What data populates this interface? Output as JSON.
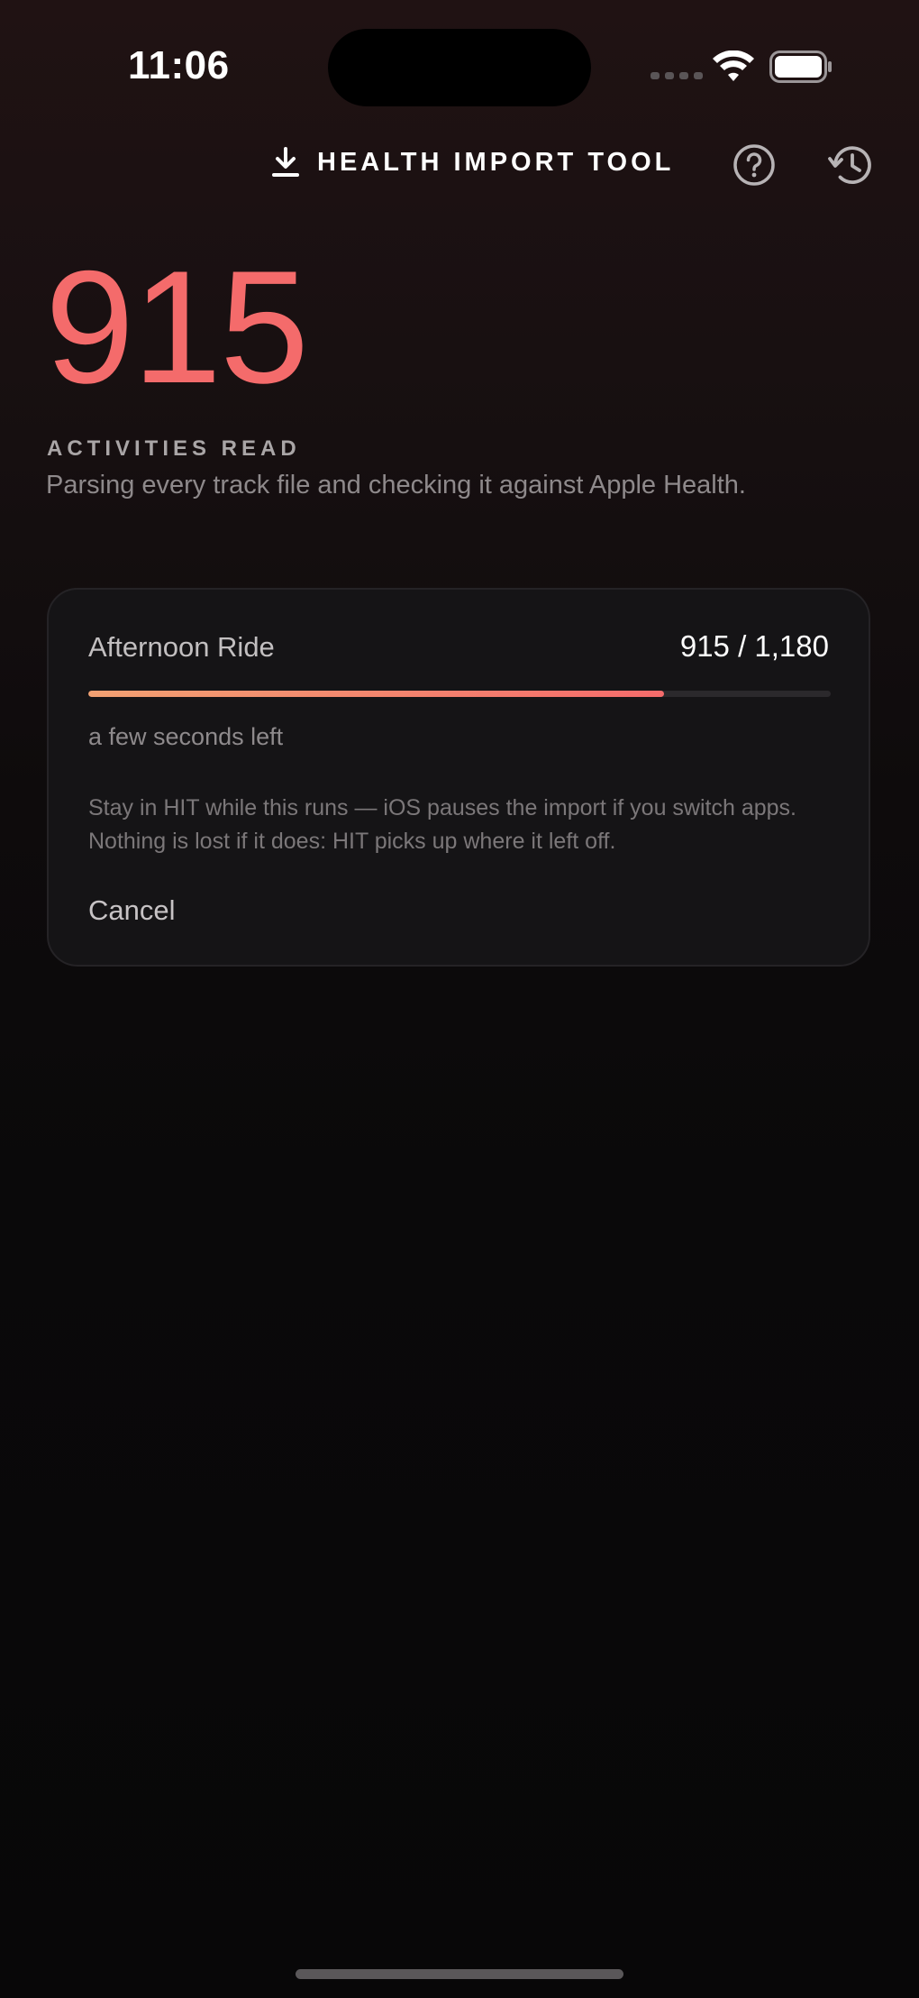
{
  "status_bar": {
    "time": "11:06"
  },
  "header": {
    "title": "HEALTH IMPORT TOOL",
    "title_icon": "download-icon",
    "help_icon": "question-circle-icon",
    "history_icon": "history-clock-icon"
  },
  "summary": {
    "count": "915",
    "label": "ACTIVITIES READ",
    "description": "Parsing every track file and checking it against Apple Health."
  },
  "progress_card": {
    "activity_name": "Afternoon Ride",
    "progress_text": "915 / 1,180",
    "progress_fraction": 0.7754,
    "time_left": "a few seconds left",
    "hint": "Stay in HIT while this runs — iOS pauses the import if you switch apps. Nothing is lost if it does: HIT picks up where it left off.",
    "cancel_label": "Cancel"
  },
  "colors": {
    "accent": "#f46b6b",
    "accent_gradient_start": "#f2a172",
    "card_background": "#151416"
  }
}
